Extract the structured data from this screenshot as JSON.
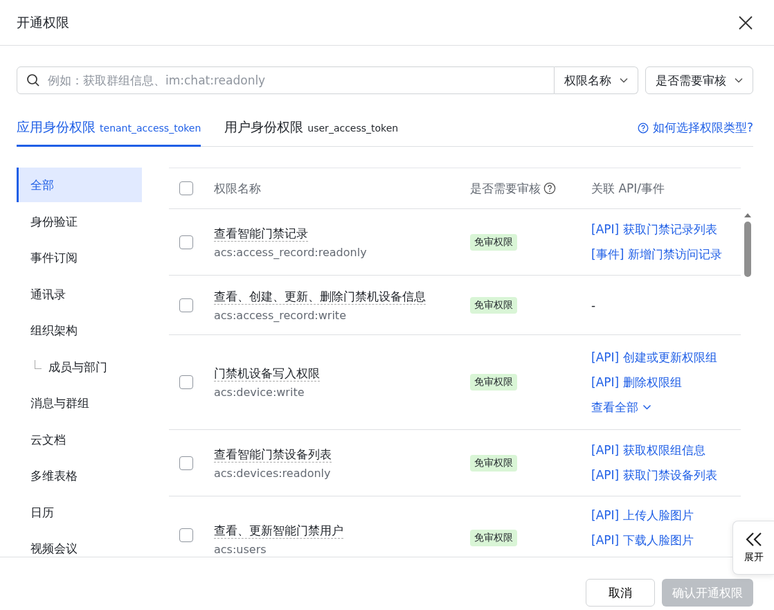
{
  "dialog": {
    "title": "开通权限"
  },
  "search": {
    "placeholder": "例如：获取群组信息、im:chat:readonly",
    "scope": "权限名称",
    "filter": "是否需要审核"
  },
  "tabs": [
    {
      "label": "应用身份权限",
      "token": "tenant_access_token",
      "selected": true
    },
    {
      "label": "用户身份权限",
      "token": "user_access_token",
      "selected": false
    }
  ],
  "help_link": "如何选择权限类型?",
  "sidebar": {
    "items": [
      {
        "label": "全部",
        "selected": true
      },
      {
        "label": "身份验证",
        "selected": false
      },
      {
        "label": "事件订阅",
        "selected": false
      },
      {
        "label": "通讯录",
        "selected": false
      },
      {
        "label": "组织架构",
        "selected": false,
        "children": [
          {
            "label": "成员与部门",
            "selected": false
          }
        ]
      },
      {
        "label": "消息与群组",
        "selected": false
      },
      {
        "label": "云文档",
        "selected": false
      },
      {
        "label": "多维表格",
        "selected": false
      },
      {
        "label": "日历",
        "selected": false
      },
      {
        "label": "视频会议",
        "selected": false
      }
    ]
  },
  "table": {
    "columns": [
      "权限名称",
      "是否需要审核",
      "关联 API/事件"
    ],
    "header_checked": false,
    "rows": [
      {
        "checked": false,
        "name": "查看智能门禁记录",
        "code": "acs:access_record:readonly",
        "review": "免审权限",
        "links": [
          {
            "kind": "link",
            "text": "[API] 获取门禁记录列表"
          },
          {
            "kind": "link",
            "text": "[事件] 新增门禁访问记录"
          }
        ]
      },
      {
        "checked": false,
        "name": "查看、创建、更新、删除门禁机设备信息",
        "code": "acs:access_record:write",
        "review": "免审权限",
        "links": [
          {
            "kind": "plain",
            "text": "-"
          }
        ]
      },
      {
        "checked": false,
        "name": "门禁机设备写入权限",
        "code": "acs:device:write",
        "review": "免审权限",
        "links": [
          {
            "kind": "link",
            "text": "[API] 创建或更新权限组"
          },
          {
            "kind": "link",
            "text": "[API] 删除权限组"
          },
          {
            "kind": "more",
            "text": "查看全部"
          }
        ]
      },
      {
        "checked": false,
        "name": "查看智能门禁设备列表",
        "code": "acs:devices:readonly",
        "review": "免审权限",
        "links": [
          {
            "kind": "link",
            "text": "[API] 获取权限组信息"
          },
          {
            "kind": "link",
            "text": "[API] 获取门禁设备列表"
          }
        ]
      },
      {
        "checked": false,
        "name": "查看、更新智能门禁用户",
        "code": "acs:users",
        "review": "免审权限",
        "links": [
          {
            "kind": "link",
            "text": "[API] 上传人脸图片"
          },
          {
            "kind": "link",
            "text": "[API] 下载人脸图片"
          }
        ]
      }
    ]
  },
  "expand_button": "展开",
  "buttons": {
    "cancel": "取消",
    "confirm": "确认开通权限"
  }
}
